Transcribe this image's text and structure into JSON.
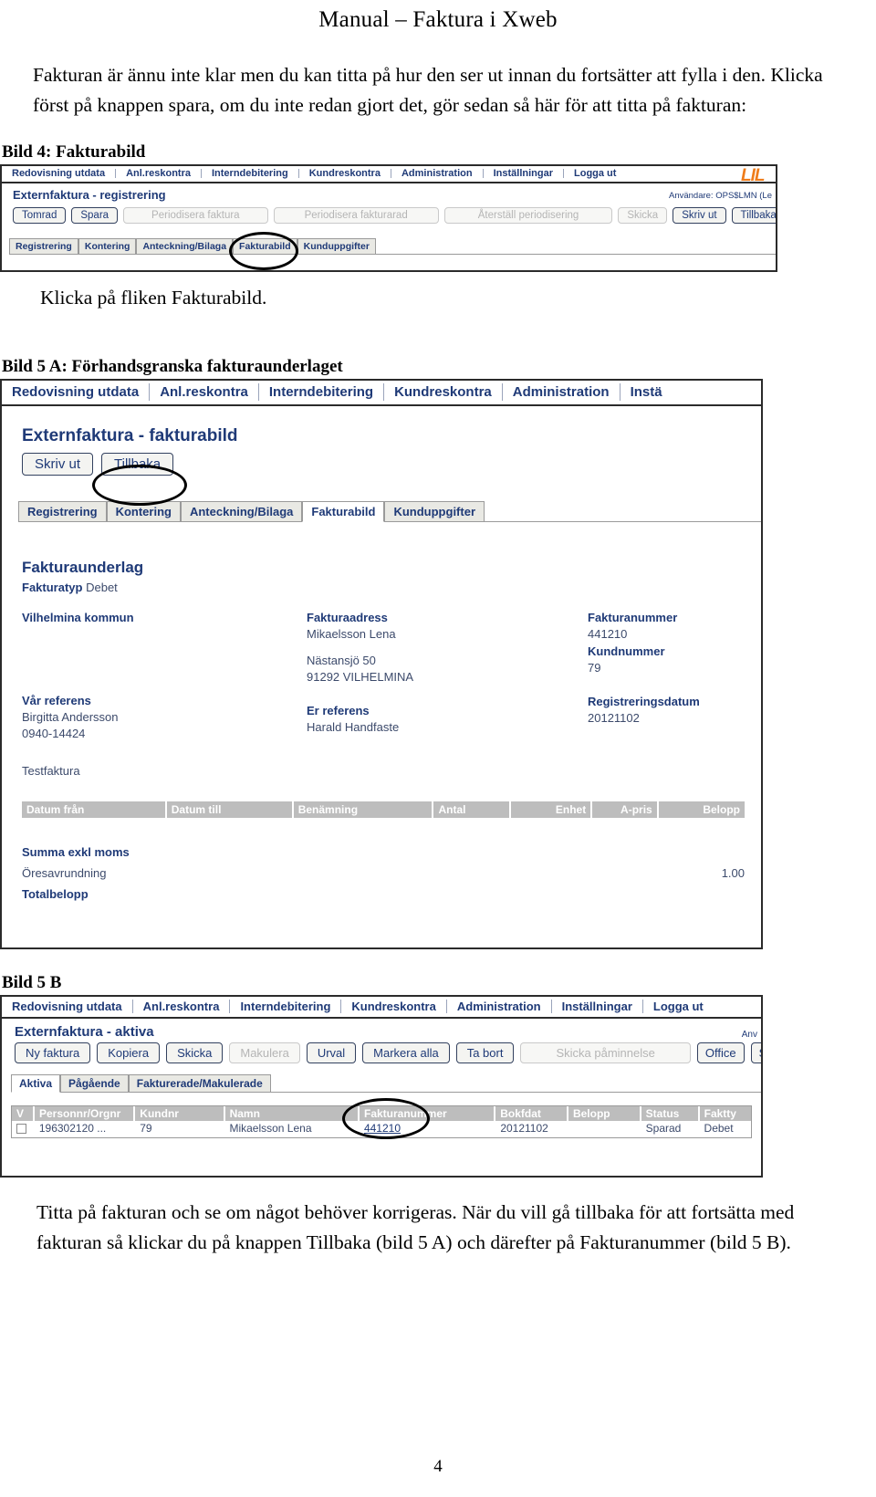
{
  "document": {
    "title": "Manual – Faktura i Xweb",
    "intro_paragraph": "Fakturan är ännu inte klar men du kan titta på hur den ser ut innan du fortsätter att fylla i den. Klicka först på knappen spara, om du inte redan gjort det, gör sedan så här för att titta på fakturan:",
    "caption_bild4": "Bild 4: Fakturabild",
    "note_after_bild4": "Klicka på fliken Fakturabild.",
    "caption_bild5a": "Bild 5 A: Förhandsgranska fakturaunderlaget",
    "caption_bild5b": "Bild 5 B",
    "closing_paragraph": "Titta på fakturan och se om något behöver korrigeras. När du vill gå tillbaka för att fortsätta med fakturan så klickar du på knappen Tillbaka (bild 5 A) och därefter på Fakturanummer (bild 5 B).",
    "page_number": "4"
  },
  "colors": {
    "link_blue": "#1f3a77",
    "logo_orange": "#ef7c1a",
    "grid_header_grey": "#bdbdbd",
    "annotation_black": "#000000"
  },
  "bild4": {
    "menu": [
      "Redovisning utdata",
      "Anl.reskontra",
      "Interndebitering",
      "Kundreskontra",
      "Administration",
      "Inställningar",
      "Logga ut"
    ],
    "logo_text": "LIL",
    "page_heading": "Externfaktura - registrering",
    "user_info": "Användare: OPS$LMN (Le",
    "buttons": [
      {
        "label": "Tomrad",
        "disabled": false
      },
      {
        "label": "Spara",
        "disabled": false
      },
      {
        "label": "Periodisera faktura",
        "disabled": true
      },
      {
        "label": "Periodisera fakturarad",
        "disabled": true
      },
      {
        "label": "Återställ periodisering",
        "disabled": true
      },
      {
        "label": "Skicka",
        "disabled": true
      },
      {
        "label": "Skriv ut",
        "disabled": false
      },
      {
        "label": "Tillbaka",
        "disabled": false
      }
    ],
    "tabs": [
      {
        "label": "Registrering",
        "active": false
      },
      {
        "label": "Kontering",
        "active": false
      },
      {
        "label": "Anteckning/Bilaga",
        "active": false
      },
      {
        "label": "Fakturabild",
        "active": false
      },
      {
        "label": "Kunduppgifter",
        "active": false
      }
    ],
    "annotation_target": "Fakturabild"
  },
  "bild5a": {
    "menu": [
      "Redovisning utdata",
      "Anl.reskontra",
      "Interndebitering",
      "Kundreskontra",
      "Administration",
      "Instä"
    ],
    "page_heading": "Externfaktura - fakturabild",
    "buttons": [
      {
        "label": "Skriv ut",
        "disabled": false
      },
      {
        "label": "Tillbaka",
        "disabled": false
      }
    ],
    "tabs": [
      {
        "label": "Registrering",
        "active": false
      },
      {
        "label": "Kontering",
        "active": false
      },
      {
        "label": "Anteckning/Bilaga",
        "active": false
      },
      {
        "label": "Fakturabild",
        "active": true
      },
      {
        "label": "Kunduppgifter",
        "active": false
      }
    ],
    "annotation_target": "Tillbaka",
    "invoice": {
      "heading": "Fakturaunderlag",
      "type_label": "Fakturatyp",
      "type_value": "Debet",
      "sender_name": "Vilhelmina kommun",
      "our_reference_label": "Vår referens",
      "our_reference_name": "Birgitta Andersson",
      "our_reference_phone": "0940-14424",
      "note": "Testfaktura",
      "invoice_address_label": "Fakturaadress",
      "invoice_address_lines": [
        "Mikaelsson Lena",
        "Nästansjö 50",
        "91292 VILHELMINA"
      ],
      "your_reference_label": "Er referens",
      "your_reference_value": "Harald Handfaste",
      "invoice_number_label": "Fakturanummer",
      "invoice_number_value": "441210",
      "customer_number_label": "Kundnummer",
      "customer_number_value": "79",
      "reg_date_label": "Registreringsdatum",
      "reg_date_value": "20121102",
      "grid_columns": [
        "Datum från",
        "Datum till",
        "Benämning",
        "Antal",
        "Enhet",
        "A-pris",
        "Belopp"
      ],
      "grid_rows": [],
      "totals": [
        {
          "label": "Summa exkl moms",
          "value": "",
          "bold": true
        },
        {
          "label": "Öresavrundning",
          "value": "1.00",
          "bold": false
        },
        {
          "label": "Totalbelopp",
          "value": "",
          "bold": true
        }
      ]
    }
  },
  "bild5b": {
    "menu": [
      "Redovisning utdata",
      "Anl.reskontra",
      "Interndebitering",
      "Kundreskontra",
      "Administration",
      "Inställningar",
      "Logga ut"
    ],
    "page_heading": "Externfaktura - aktiva",
    "user_info": "Anv",
    "buttons": [
      {
        "label": "Ny faktura",
        "disabled": false
      },
      {
        "label": "Kopiera",
        "disabled": false
      },
      {
        "label": "Skicka",
        "disabled": false
      },
      {
        "label": "Makulera",
        "disabled": true
      },
      {
        "label": "Urval",
        "disabled": false
      },
      {
        "label": "Markera alla",
        "disabled": false
      },
      {
        "label": "Ta bort",
        "disabled": false
      },
      {
        "label": "Skicka påminnelse",
        "disabled": true
      },
      {
        "label": "Office",
        "disabled": false
      },
      {
        "label": "Sk",
        "disabled": false
      }
    ],
    "tabs": [
      {
        "label": "Aktiva",
        "active": true
      },
      {
        "label": "Pågående",
        "active": false
      },
      {
        "label": "Fakturerade/Makulerade",
        "active": false
      }
    ],
    "annotation_target": "441210",
    "grid_columns": [
      "V",
      "Personnr/Orgnr",
      "Kundnr",
      "Namn",
      "Fakturanummer",
      "Bokfdat",
      "Belopp",
      "Status",
      "Faktty"
    ],
    "grid_rows": [
      {
        "checkbox": "",
        "personnr": "196302120 ...",
        "kundnr": "79",
        "namn": "Mikaelsson Lena",
        "fakturanummer": "441210",
        "bokfdat": "20121102",
        "belopp": "",
        "status": "Sparad",
        "fakttyp": "Debet"
      }
    ]
  }
}
